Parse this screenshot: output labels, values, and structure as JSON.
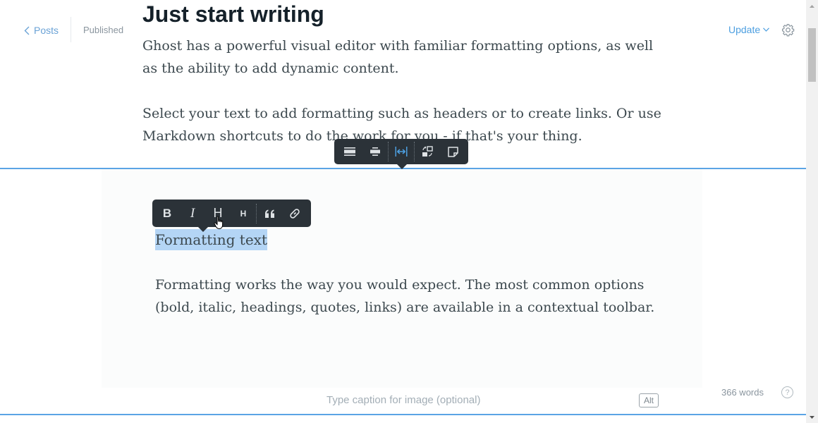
{
  "nav": {
    "back_label": "Posts",
    "status": "Published",
    "update_label": "Update"
  },
  "post": {
    "title": "Just start writing",
    "paragraph_1": "Ghost has a powerful visual editor with familiar formatting options, as well as the ability to add dynamic content.",
    "paragraph_2": "Select your text to add formatting such as headers or to create links. Or use Markdown shortcuts to do the work for you - if that's your thing."
  },
  "card": {
    "heading": "Formatting text",
    "paragraph": "Formatting works the way you would expect. The most common options (bold, italic, headings, quotes, links) are available in a contextual toolbar.",
    "caption_placeholder": "Type caption for image (optional)",
    "alt_label": "Alt"
  },
  "card_toolbar": {
    "buttons": [
      "width-regular-icon",
      "width-wide-icon",
      "width-full-icon",
      "replace-image-icon",
      "snippet-icon"
    ],
    "active": "width-full-icon"
  },
  "format_toolbar": {
    "bold_label": "B",
    "italic_label": "I",
    "h2_label": "H",
    "h3_label": "H",
    "buttons": [
      "bold-icon",
      "italic-icon",
      "heading-large-icon",
      "heading-small-icon",
      "quote-icon",
      "link-icon"
    ]
  },
  "footer": {
    "word_count": "366 words",
    "help_label": "?"
  },
  "colors": {
    "accent": "#5ba4e5",
    "toolbar_bg": "#2b3238",
    "selection": "#b4d5f5"
  }
}
